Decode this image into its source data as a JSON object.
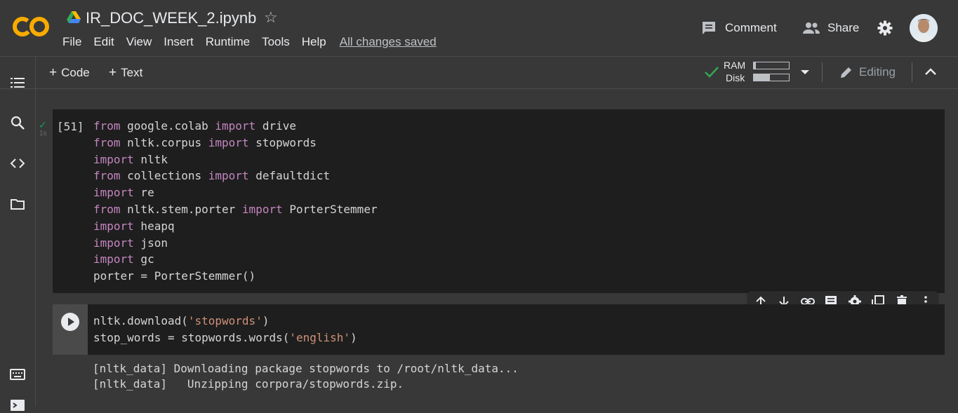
{
  "header": {
    "notebook_title": "IR_DOC_WEEK_2.ipynb",
    "menu": [
      "File",
      "Edit",
      "View",
      "Insert",
      "Runtime",
      "Tools",
      "Help"
    ],
    "save_status": "All changes saved",
    "comment_label": "Comment",
    "share_label": "Share"
  },
  "toolbar": {
    "add_code_label": "Code",
    "add_text_label": "Text",
    "ram_label": "RAM",
    "disk_label": "Disk",
    "ram_usage_fraction": 0.05,
    "disk_usage_fraction": 0.45,
    "editing_label": "Editing"
  },
  "cells": [
    {
      "execution_count": "[51]",
      "status": "done",
      "exec_time": "1s",
      "code_lines": [
        "from google.colab import drive",
        "from nltk.corpus import stopwords",
        "import nltk",
        "from collections import defaultdict",
        "import re",
        "from nltk.stem.porter import PorterStemmer",
        "import heapq",
        "import json",
        "import gc",
        "porter = PorterStemmer()"
      ]
    },
    {
      "code_lines": [
        "nltk.download('stopwords')",
        "stop_words = stopwords.words('english')"
      ],
      "output_lines": [
        "[nltk_data] Downloading package stopwords to /root/nltk_data...",
        "[nltk_data]   Unzipping corpora/stopwords.zip."
      ]
    }
  ],
  "colors": {
    "background": "#383838",
    "cell_background": "#1e1e1e",
    "keyword": "#c586c0",
    "string": "#ce9178",
    "success": "#0f9d58"
  }
}
